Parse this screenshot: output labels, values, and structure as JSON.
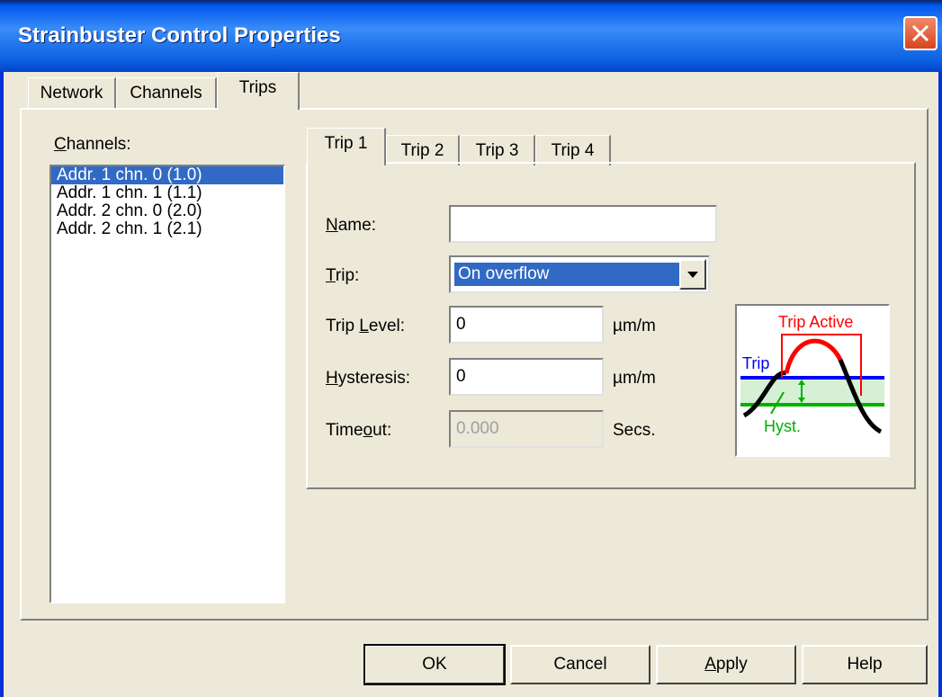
{
  "window": {
    "title": "Strainbuster Control Properties"
  },
  "tabs": [
    {
      "label": "Network"
    },
    {
      "label": "Channels"
    },
    {
      "label": "Trips",
      "active": true
    }
  ],
  "channels": {
    "label_prefix": "C",
    "label_rest": "hannels:",
    "items": [
      {
        "label": "Addr. 1 chn. 0 (1.0)",
        "selected": true
      },
      {
        "label": "Addr. 1 chn. 1 (1.1)"
      },
      {
        "label": "Addr. 2 chn. 0 (2.0)"
      },
      {
        "label": "Addr. 2 chn. 1 (2.1)"
      }
    ]
  },
  "trip_tabs": [
    {
      "label": "Trip 1",
      "active": true
    },
    {
      "label": "Trip 2"
    },
    {
      "label": "Trip 3"
    },
    {
      "label": "Trip 4"
    }
  ],
  "form": {
    "name_label_u": "N",
    "name_label_rest": "ame:",
    "name_value": "",
    "trip_label_u": "T",
    "trip_label_rest": "rip:",
    "trip_value": "On overflow",
    "trip_level_label_pre": "Trip ",
    "trip_level_label_u": "L",
    "trip_level_label_rest": "evel:",
    "trip_level_value": "0",
    "trip_level_unit": "µm/m",
    "hysteresis_label_u": "H",
    "hysteresis_label_rest": "ysteresis:",
    "hysteresis_value": "0",
    "hysteresis_unit": "µm/m",
    "timeout_label_pre": "Time",
    "timeout_label_u": "o",
    "timeout_label_rest": "ut:",
    "timeout_value": "0.000",
    "timeout_unit": "Secs."
  },
  "diagram": {
    "trip_active": "Trip Active",
    "trip": "Trip",
    "hyst": "Hyst.",
    "colors": {
      "active": "#ff0000",
      "trip": "#0000ff",
      "hyst": "#00b000",
      "band": "#d6f0d6"
    }
  },
  "buttons": {
    "ok": "OK",
    "cancel": "Cancel",
    "apply_u": "A",
    "apply_rest": "pply",
    "help": "Help"
  }
}
